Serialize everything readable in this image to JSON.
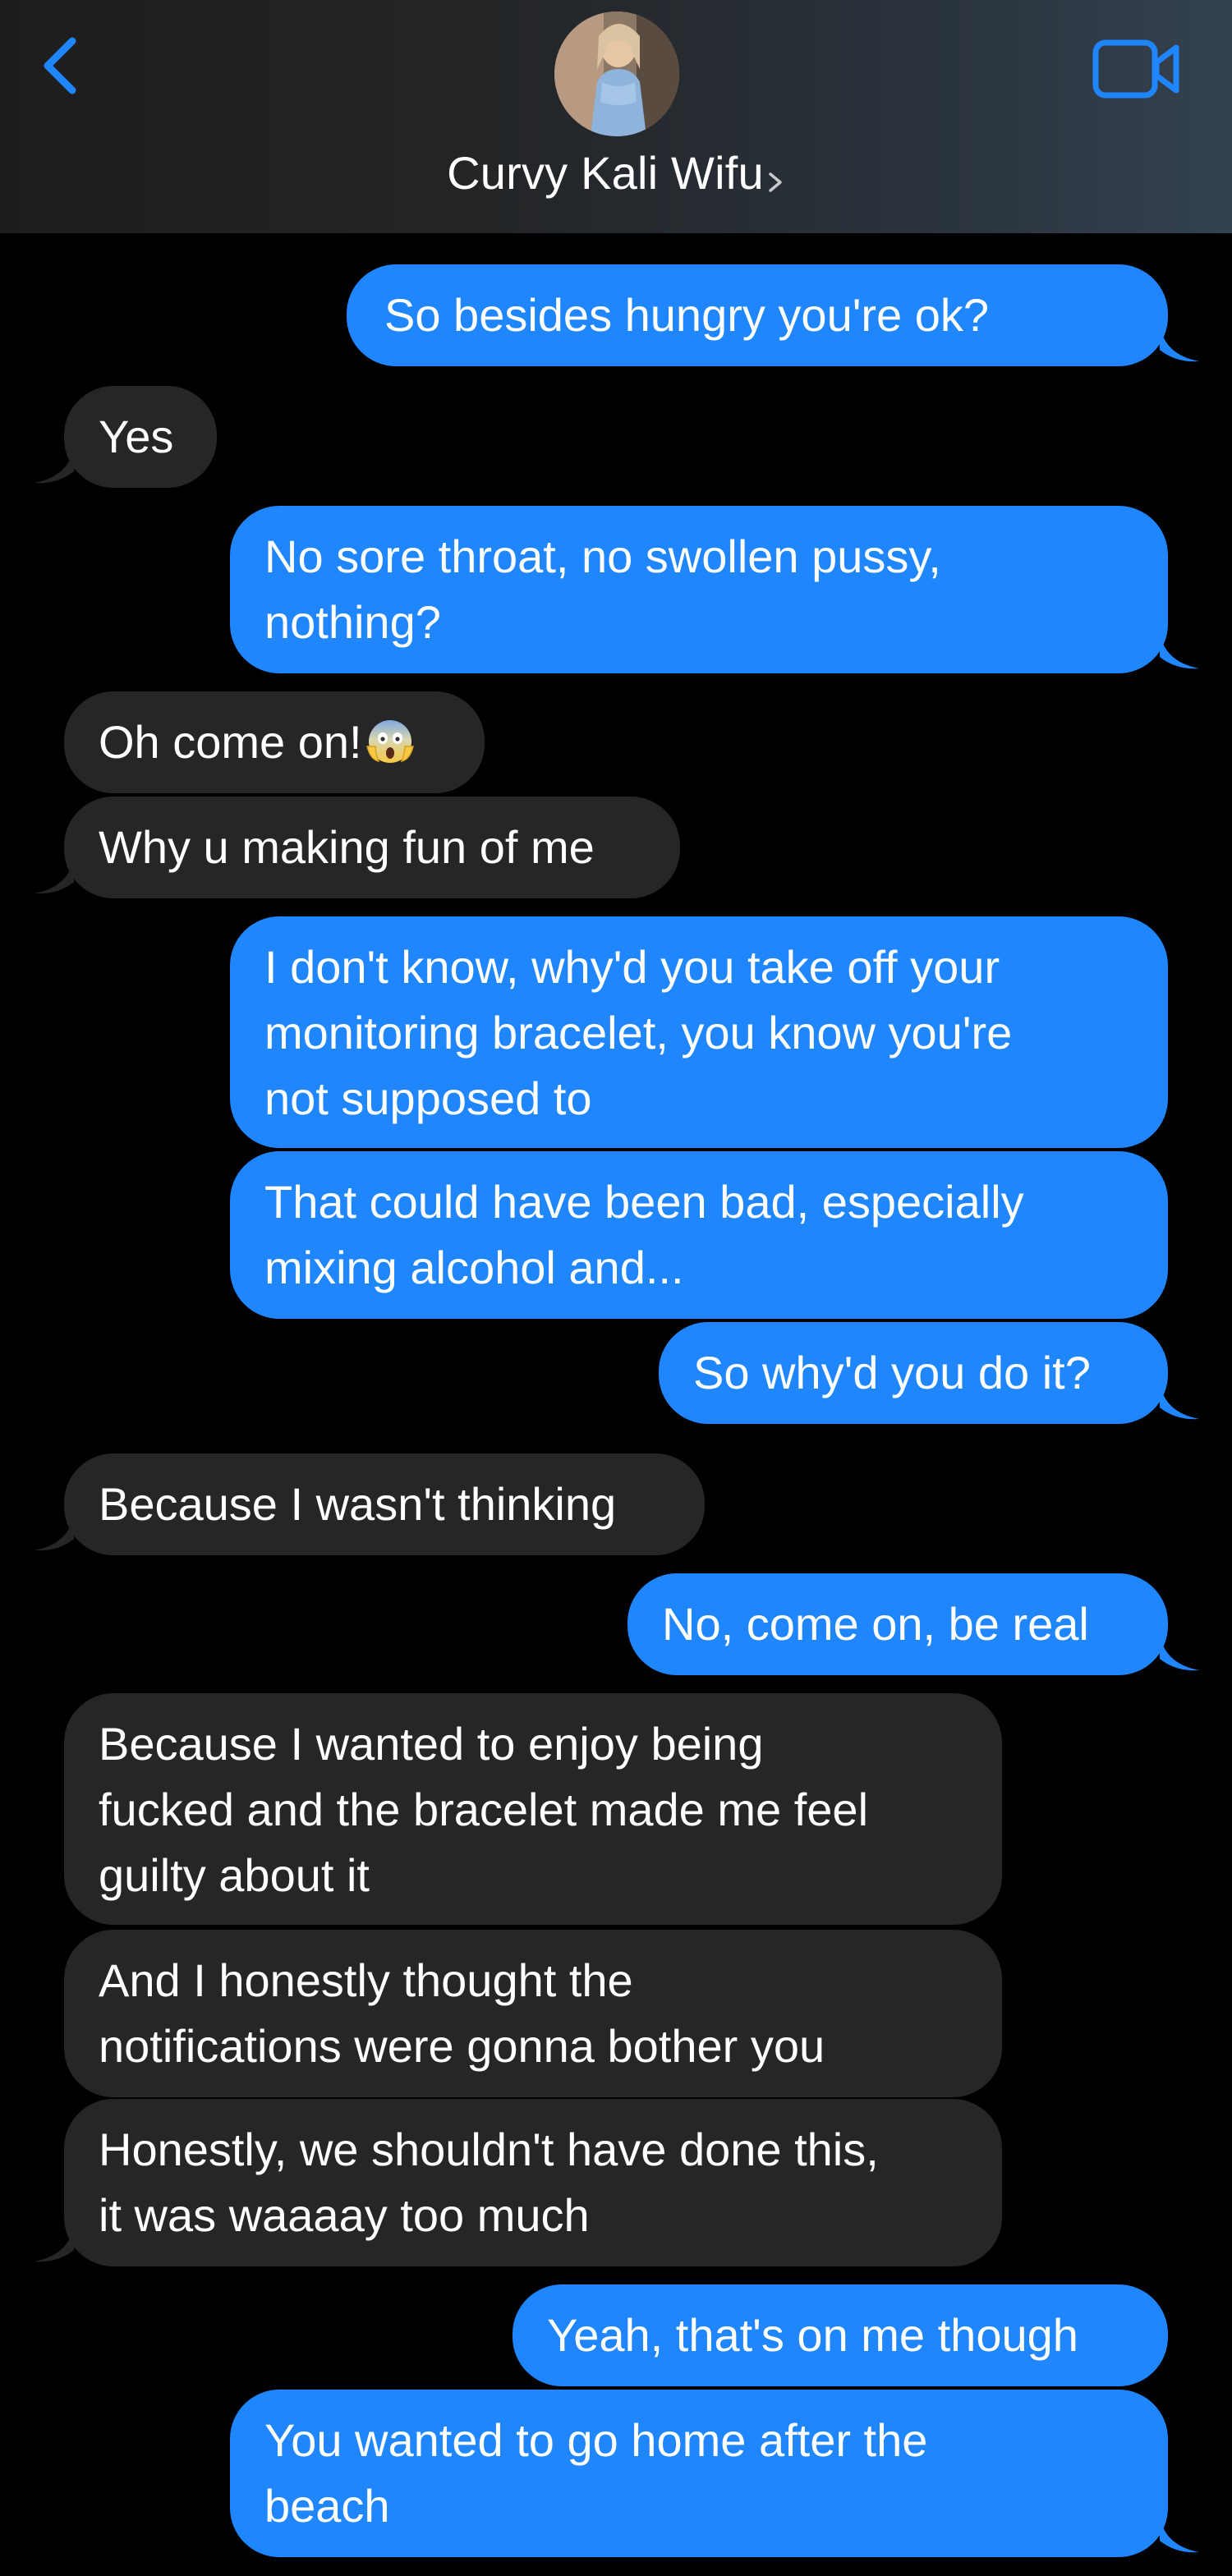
{
  "header": {
    "contact_name": "Curvy Kali Wifu",
    "back_icon": "chevron-left-icon",
    "video_icon": "video-camera-icon",
    "accent_color": "#1f86fe"
  },
  "colors": {
    "outgoing_bubble": "#1f86fe",
    "incoming_bubble": "#262628",
    "background": "#000000"
  },
  "messages": [
    {
      "from": "me",
      "lines": [
        "So besides hungry you're ok?"
      ]
    },
    {
      "from": "them",
      "lines": [
        "Yes"
      ]
    },
    {
      "from": "me",
      "lines": [
        "No sore throat, no swollen pussy,",
        "nothing?"
      ]
    },
    {
      "from": "them",
      "lines": [
        "Oh come on!"
      ],
      "emoji": "face-screaming-in-fear"
    },
    {
      "from": "them",
      "lines": [
        "Why u making fun of me"
      ]
    },
    {
      "from": "me",
      "lines": [
        "I don't know, why'd you take off your",
        "monitoring bracelet, you know you're",
        "not supposed to"
      ]
    },
    {
      "from": "me",
      "lines": [
        "That could have been bad, especially",
        "mixing alcohol and..."
      ]
    },
    {
      "from": "me",
      "lines": [
        "So why'd you do it?"
      ]
    },
    {
      "from": "them",
      "lines": [
        "Because I wasn't thinking"
      ]
    },
    {
      "from": "me",
      "lines": [
        "No, come on, be real"
      ]
    },
    {
      "from": "them",
      "lines": [
        "Because I wanted to enjoy being",
        "fucked and the bracelet made me feel",
        "guilty about it"
      ]
    },
    {
      "from": "them",
      "lines": [
        "And I honestly thought the",
        "notifications were gonna bother you"
      ]
    },
    {
      "from": "them",
      "lines": [
        "Honestly, we shouldn't have done this,",
        "it was waaaay too much"
      ]
    },
    {
      "from": "me",
      "lines": [
        "Yeah, that's on me though"
      ]
    },
    {
      "from": "me",
      "lines": [
        "You wanted to go home after the",
        "beach"
      ]
    }
  ]
}
